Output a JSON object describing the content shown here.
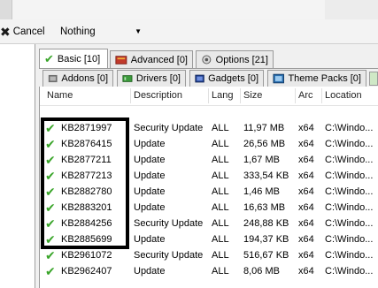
{
  "toolbar": {
    "cancel_label": "Cancel",
    "dropdown_value": "Nothing",
    "dropdown_arrow": "▼"
  },
  "tabs_row1": [
    {
      "label": "Basic [10]",
      "icon": "checkmark-icon"
    },
    {
      "label": "Advanced [0]",
      "icon": "warning-icon"
    },
    {
      "label": "Options [21]",
      "icon": "options-icon"
    }
  ],
  "tabs_row2": [
    {
      "label": "Addons [0]",
      "icon": "addons-icon"
    },
    {
      "label": "Drivers [0]",
      "icon": "drivers-icon"
    },
    {
      "label": "Gadgets [0]",
      "icon": "gadgets-icon"
    },
    {
      "label": "Theme Packs [0]",
      "icon": "theme-packs-icon"
    }
  ],
  "columns": [
    "Name",
    "Description",
    "Lang",
    "Size",
    "Arc",
    "Location"
  ],
  "rows": [
    {
      "name": "KB2871997",
      "description": "Security Update",
      "lang": "ALL",
      "size": "11,97 MB",
      "arc": "x64",
      "location": "C:\\Windo..."
    },
    {
      "name": "KB2876415",
      "description": "Update",
      "lang": "ALL",
      "size": "26,56 MB",
      "arc": "x64",
      "location": "C:\\Windo..."
    },
    {
      "name": "KB2877211",
      "description": "Update",
      "lang": "ALL",
      "size": "1,67 MB",
      "arc": "x64",
      "location": "C:\\Windo..."
    },
    {
      "name": "KB2877213",
      "description": "Update",
      "lang": "ALL",
      "size": "333,54 KB",
      "arc": "x64",
      "location": "C:\\Windo..."
    },
    {
      "name": "KB2882780",
      "description": "Update",
      "lang": "ALL",
      "size": "1,46 MB",
      "arc": "x64",
      "location": "C:\\Windo..."
    },
    {
      "name": "KB2883201",
      "description": "Update",
      "lang": "ALL",
      "size": "16,63 MB",
      "arc": "x64",
      "location": "C:\\Windo..."
    },
    {
      "name": "KB2884256",
      "description": "Security Update",
      "lang": "ALL",
      "size": "248,88 KB",
      "arc": "x64",
      "location": "C:\\Windo..."
    },
    {
      "name": "KB2885699",
      "description": "Update",
      "lang": "ALL",
      "size": "194,37 KB",
      "arc": "x64",
      "location": "C:\\Windo..."
    },
    {
      "name": "KB2961072",
      "description": "Security Update",
      "lang": "ALL",
      "size": "516,67 KB",
      "arc": "x64",
      "location": "C:\\Windo..."
    },
    {
      "name": "KB2962407",
      "description": "Update",
      "lang": "ALL",
      "size": "8,06 MB",
      "arc": "x64",
      "location": "C:\\Windo..."
    }
  ],
  "colors": {
    "check_green": "#3aa52a",
    "highlight_border": "#000000"
  }
}
